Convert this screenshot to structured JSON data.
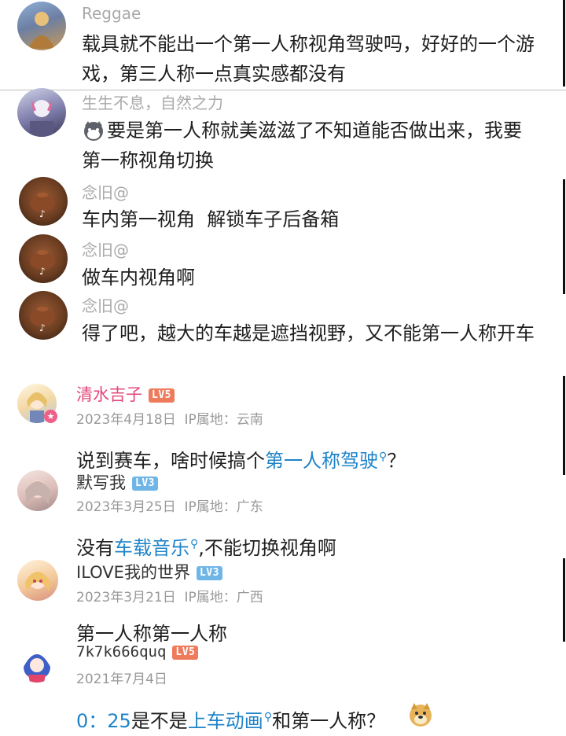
{
  "top_comments": [
    {
      "name": "Reggae",
      "text": "载具就不能出一个第一人称视角驾驶吗，好好的一个游戏，第三人称一点真实感都没有",
      "avatar_color": "#6d7fa3"
    },
    {
      "name": "生生不息，自然之力",
      "text": "要是第一人称就美滋滋了不知道能否做出来，我要第一称视角切换",
      "avatar_color": "#7c7aa8"
    },
    {
      "name": "念旧@",
      "text": "车内第一视角  解锁车子后备箱",
      "avatar_color": "#6b3d21"
    },
    {
      "name": "念旧@",
      "text": "做车内视角啊",
      "avatar_color": "#6b3d21"
    },
    {
      "name": "念旧@",
      "text": "得了吧，越大的车越是遮挡视野，又不能第一人称开车",
      "avatar_color": "#6b3d21"
    }
  ],
  "forum_posts": [
    {
      "username": "清水吉子",
      "username_color": "#e2497a",
      "level": "LV5",
      "level_style": "red",
      "date": "2023年4月18日",
      "ip": "IP属地：云南",
      "comment_prefix": "说到赛车，啥时候搞个",
      "comment_link": "第一人称驾驶",
      "comment_suffix": "？"
    },
    {
      "username": "默写我",
      "username_color": "#333333",
      "level": "LV3",
      "level_style": "blue",
      "date": "2023年3月25日",
      "ip": "IP属地：广东",
      "comment_prefix": "没有",
      "comment_link": "车载音乐",
      "comment_suffix": ",不能切换视角啊"
    },
    {
      "username": "ILOVE我的世界",
      "username_color": "#333333",
      "level": "LV3",
      "level_style": "blue",
      "date": "2023年3月21日",
      "ip": "IP属地：广西",
      "comment_prefix": "第一人称第一人称",
      "comment_link": "",
      "comment_suffix": ""
    },
    {
      "username": "7k7k666quq",
      "username_color": "#333333",
      "level": "LV5",
      "level_style": "red",
      "date": "2021年7月4日",
      "ip": "",
      "comment_prefix": "0：25",
      "comment_middle": "是不是",
      "comment_link": "上车动画",
      "comment_suffix": "和第一人称？"
    }
  ],
  "icons": {
    "search": "search-icon",
    "doge": "doge-emoji-icon",
    "cat": "cat-emoji-icon",
    "tiktok": "tiktok-icon"
  },
  "colors": {
    "link": "#1f84c9",
    "meta": "#999999",
    "gray_name": "#a9a9a9"
  }
}
